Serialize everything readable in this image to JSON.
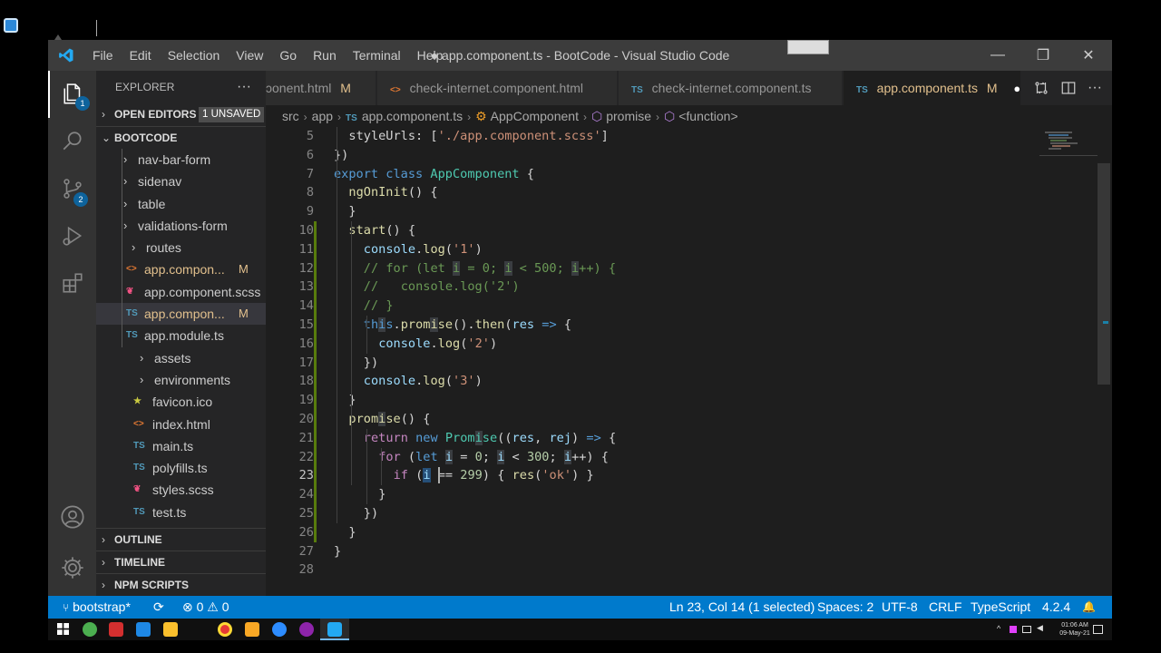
{
  "window": {
    "title": "● app.component.ts - BootCode - Visual Studio Code",
    "menu": [
      "File",
      "Edit",
      "Selection",
      "View",
      "Go",
      "Run",
      "Terminal",
      "Help"
    ],
    "controls": {
      "minimize": "—",
      "restore": "❐",
      "close": "✕"
    }
  },
  "activity_bar": {
    "items": [
      {
        "name": "explorer",
        "badge": "1"
      },
      {
        "name": "search",
        "badge": ""
      },
      {
        "name": "source-control",
        "badge": "2"
      },
      {
        "name": "run-debug",
        "badge": ""
      },
      {
        "name": "extensions",
        "badge": ""
      },
      {
        "name": "accounts",
        "badge": ""
      },
      {
        "name": "manage",
        "badge": ""
      }
    ]
  },
  "sidebar": {
    "title": "EXPLORER",
    "more": "···",
    "open_editors": {
      "label": "OPEN EDITORS",
      "badge": "1 UNSAVED"
    },
    "root": {
      "label": "BOOTCODE"
    },
    "tree": [
      {
        "type": "folder",
        "name": "nav-bar-form",
        "level": 2
      },
      {
        "type": "folder",
        "name": "sidenav",
        "level": 2
      },
      {
        "type": "folder",
        "name": "table",
        "level": 2
      },
      {
        "type": "folder",
        "name": "validations-form",
        "level": 2
      },
      {
        "type": "folder",
        "name": "routes",
        "level": 1
      },
      {
        "type": "html",
        "icon": "<>",
        "name": "app.compon...",
        "mark": "M",
        "level": 1
      },
      {
        "type": "scss",
        "icon": "❦",
        "name": "app.component.scss",
        "mark": "",
        "level": 1
      },
      {
        "type": "ts",
        "icon": "TS",
        "name": "app.compon...",
        "mark": "M",
        "level": 1,
        "selected": true
      },
      {
        "type": "ts",
        "icon": "TS",
        "name": "app.module.ts",
        "mark": "",
        "level": 1
      },
      {
        "type": "folder",
        "name": "assets",
        "level": 0
      },
      {
        "type": "folder",
        "name": "environments",
        "level": 0
      },
      {
        "type": "ico",
        "icon": "★",
        "name": "favicon.ico",
        "mark": "",
        "level": 0
      },
      {
        "type": "html",
        "icon": "<>",
        "name": "index.html",
        "mark": "",
        "level": 0
      },
      {
        "type": "ts",
        "icon": "TS",
        "name": "main.ts",
        "mark": "",
        "level": 0
      },
      {
        "type": "ts",
        "icon": "TS",
        "name": "polyfills.ts",
        "mark": "",
        "level": 0
      },
      {
        "type": "scss",
        "icon": "❦",
        "name": "styles.scss",
        "mark": "",
        "level": 0
      },
      {
        "type": "ts",
        "icon": "TS",
        "name": "test.ts",
        "mark": "",
        "level": 0
      }
    ],
    "footer_sections": [
      "OUTLINE",
      "TIMELINE",
      "NPM SCRIPTS"
    ]
  },
  "tabs": [
    {
      "icon": "",
      "label": "ɔonent.html",
      "mark": "M"
    },
    {
      "icon": "<>",
      "label": "check-internet.component.html",
      "mark": ""
    },
    {
      "icon": "TS",
      "label": "check-internet.component.ts",
      "mark": ""
    },
    {
      "icon": "TS",
      "label": "app.component.ts",
      "mark": "M",
      "dirty": "●"
    }
  ],
  "breadcrumb": {
    "parts": [
      "src",
      "app",
      "app.component.ts",
      "AppComponent",
      "promise",
      "<function>"
    ]
  },
  "editor": {
    "current_line": 23,
    "lines": [
      {
        "n": 5,
        "indent": 1,
        "code": [
          [
            "plain",
            "styleUrls: ["
          ],
          [
            "str",
            "'./app.component.scss'"
          ],
          [
            "plain",
            "]"
          ]
        ]
      },
      {
        "n": 6,
        "indent": 0,
        "code": [
          [
            "plain",
            "})"
          ]
        ]
      },
      {
        "n": 7,
        "indent": 0,
        "code": [
          [
            "kw",
            "export "
          ],
          [
            "kw",
            "class "
          ],
          [
            "cls",
            "AppComponent"
          ],
          [
            "plain",
            " {"
          ]
        ]
      },
      {
        "n": 8,
        "indent": 1,
        "code": [
          [
            "fn",
            "ngOnInit"
          ],
          [
            "plain",
            "() {"
          ]
        ]
      },
      {
        "n": 9,
        "indent": 1,
        "code": [
          [
            "plain",
            "}"
          ]
        ]
      },
      {
        "n": 10,
        "indent": 1,
        "code": [
          [
            "fn",
            "start"
          ],
          [
            "plain",
            "() {"
          ]
        ]
      },
      {
        "n": 11,
        "indent": 2,
        "code": [
          [
            "var",
            "console"
          ],
          [
            "plain",
            "."
          ],
          [
            "fn",
            "log"
          ],
          [
            "plain",
            "("
          ],
          [
            "str",
            "'1'"
          ],
          [
            "plain",
            ")"
          ]
        ]
      },
      {
        "n": 12,
        "indent": 2,
        "code": [
          [
            "cm",
            "// for (let "
          ],
          [
            "cmhl",
            "i"
          ],
          [
            "cm",
            " = 0; "
          ],
          [
            "cmhl",
            "i"
          ],
          [
            "cm",
            " < 500; "
          ],
          [
            "cmhl",
            "i"
          ],
          [
            "cm",
            "++) {"
          ]
        ]
      },
      {
        "n": 13,
        "indent": 2,
        "code": [
          [
            "cm",
            "//   console.log('2')"
          ]
        ]
      },
      {
        "n": 14,
        "indent": 2,
        "code": [
          [
            "cm",
            "// }"
          ]
        ]
      },
      {
        "n": 15,
        "indent": 2,
        "code": [
          [
            "kw",
            "th"
          ],
          [
            "kwhl",
            "i"
          ],
          [
            "kw",
            "s"
          ],
          [
            "plain",
            "."
          ],
          [
            "fn",
            "prom"
          ],
          [
            "fnhl",
            "i"
          ],
          [
            "fn",
            "se"
          ],
          [
            "plain",
            "()."
          ],
          [
            "fn",
            "then"
          ],
          [
            "plain",
            "("
          ],
          [
            "var",
            "res"
          ],
          [
            "kw",
            " =>"
          ],
          [
            "plain",
            " {"
          ]
        ]
      },
      {
        "n": 16,
        "indent": 3,
        "code": [
          [
            "var",
            "console"
          ],
          [
            "plain",
            "."
          ],
          [
            "fn",
            "log"
          ],
          [
            "plain",
            "("
          ],
          [
            "str",
            "'2'"
          ],
          [
            "plain",
            ")"
          ]
        ]
      },
      {
        "n": 17,
        "indent": 2,
        "code": [
          [
            "plain",
            "})"
          ]
        ]
      },
      {
        "n": 18,
        "indent": 2,
        "code": [
          [
            "var",
            "console"
          ],
          [
            "plain",
            "."
          ],
          [
            "fn",
            "log"
          ],
          [
            "plain",
            "("
          ],
          [
            "str",
            "'3'"
          ],
          [
            "plain",
            ")"
          ]
        ]
      },
      {
        "n": 19,
        "indent": 1,
        "code": [
          [
            "plain",
            "}"
          ]
        ]
      },
      {
        "n": 20,
        "indent": 1,
        "code": [
          [
            "fn",
            "prom"
          ],
          [
            "fnhl",
            "i"
          ],
          [
            "fn",
            "se"
          ],
          [
            "plain",
            "() {"
          ]
        ]
      },
      {
        "n": 21,
        "indent": 2,
        "code": [
          [
            "kw2",
            "return "
          ],
          [
            "kw",
            "new "
          ],
          [
            "cls",
            "Prom"
          ],
          [
            "clshl",
            "i"
          ],
          [
            "cls",
            "se"
          ],
          [
            "plain",
            "(("
          ],
          [
            "var",
            "res"
          ],
          [
            "plain",
            ", "
          ],
          [
            "var",
            "rej"
          ],
          [
            "plain",
            ") "
          ],
          [
            "kw",
            "=>"
          ],
          [
            "plain",
            " {"
          ]
        ]
      },
      {
        "n": 22,
        "indent": 3,
        "code": [
          [
            "kw2",
            "for"
          ],
          [
            "plain",
            " ("
          ],
          [
            "kw",
            "let "
          ],
          [
            "varhl",
            "i"
          ],
          [
            "plain",
            " = "
          ],
          [
            "num",
            "0"
          ],
          [
            "plain",
            "; "
          ],
          [
            "varhl",
            "i"
          ],
          [
            "plain",
            " < "
          ],
          [
            "num",
            "300"
          ],
          [
            "plain",
            "; "
          ],
          [
            "varhl",
            "i"
          ],
          [
            "plain",
            "++) {"
          ]
        ]
      },
      {
        "n": 23,
        "indent": 4,
        "code": [
          [
            "kw2",
            "if"
          ],
          [
            "plain",
            " ("
          ],
          [
            "varsel",
            "i"
          ],
          [
            "plain",
            " == "
          ],
          [
            "num",
            "299"
          ],
          [
            "plain",
            ") { "
          ],
          [
            "fn",
            "res"
          ],
          [
            "plain",
            "("
          ],
          [
            "str",
            "'ok'"
          ],
          [
            "plain",
            ") }"
          ]
        ]
      },
      {
        "n": 24,
        "indent": 3,
        "code": [
          [
            "plain",
            "}"
          ]
        ]
      },
      {
        "n": 25,
        "indent": 2,
        "code": [
          [
            "plain",
            "})"
          ]
        ]
      },
      {
        "n": 26,
        "indent": 1,
        "code": [
          [
            "plain",
            "}"
          ]
        ]
      },
      {
        "n": 27,
        "indent": 0,
        "code": [
          [
            "plain",
            "}"
          ]
        ]
      },
      {
        "n": 28,
        "indent": 0,
        "code": []
      }
    ],
    "modified_lines": [
      10,
      11,
      12,
      13,
      14,
      15,
      16,
      17,
      18,
      19,
      20,
      21,
      22,
      23,
      24,
      25,
      26
    ]
  },
  "statusbar": {
    "branch": "bootstrap*",
    "sync": "⟳",
    "problems": "⊗ 0 ⚠ 0",
    "cursor": "Ln 23, Col 14 (1 selected)",
    "spaces": "Spaces: 2",
    "encoding": "UTF-8",
    "eol": "CRLF",
    "language": "TypeScript",
    "version": "4.2.4",
    "bell": "🔔"
  },
  "taskbar": {
    "time": "01:06 AM",
    "date": "09-May-21"
  },
  "colors": {
    "accent": "#007acc",
    "modified": "#e2c08d",
    "ts_icon": "#519aba",
    "html_icon": "#e37933",
    "scss_icon": "#f55385"
  }
}
